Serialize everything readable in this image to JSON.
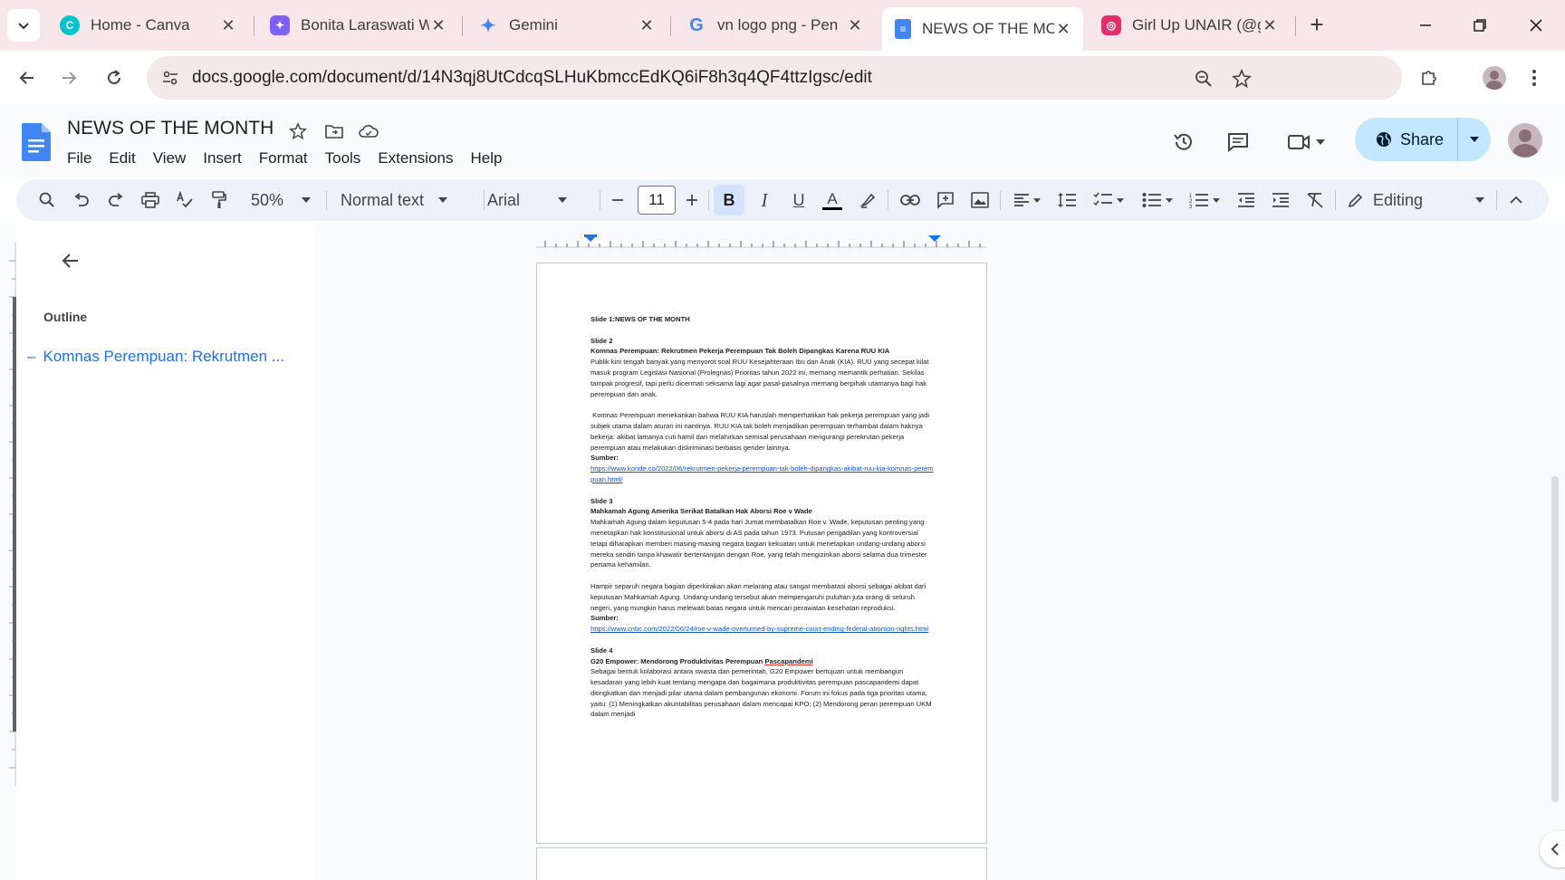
{
  "browser": {
    "tabs": [
      {
        "title": "Home - Canva",
        "favicon": "canva-icon",
        "color": "#00c4cc",
        "active": false
      },
      {
        "title": "Bonita Laraswati W",
        "favicon": "ai-chat-icon",
        "color": "#7b61ff",
        "active": false
      },
      {
        "title": "Gemini",
        "favicon": "gemini-sparkle-icon",
        "color": "#4285f4",
        "active": false
      },
      {
        "title": "vn logo png - Pen",
        "favicon": "google-g-icon",
        "color": "#4285f4",
        "active": false
      },
      {
        "title": "NEWS OF THE MO",
        "favicon": "docs-icon",
        "color": "#4285f4",
        "active": true
      },
      {
        "title": "Girl Up UNAIR (@g",
        "favicon": "instagram-icon",
        "color": "#e1306c",
        "active": false
      }
    ],
    "new_tab_label": "+",
    "url": "docs.google.com/document/d/14N3qj8UtCdcqSLHuKbmccEdKQ6iF8h3q4QF4ttzIgsc/edit"
  },
  "docs": {
    "title": "NEWS OF THE MONTH",
    "menu": [
      "File",
      "Edit",
      "View",
      "Insert",
      "Format",
      "Tools",
      "Extensions",
      "Help"
    ],
    "share_label": "Share",
    "accent": "#c2e7ff"
  },
  "toolbar": {
    "zoom": "50%",
    "style": "Normal text",
    "font": "Arial",
    "font_size": "11",
    "mode": "Editing"
  },
  "outline": {
    "label": "Outline",
    "items": [
      "Komnas Perempuan: Rekrutmen ..."
    ]
  },
  "page": {
    "slide1": "Slide 1:NEWS OF THE MONTH",
    "slide2_label": "Slide 2",
    "slide2_heading": "Komnas Perempuan: Rekrutmen Pekerja Perempuan Tak Boleh Dipangkas Karena RUU KIA",
    "slide2_p1": "Publik kini tengah banyak yang menyorot soal RUU Kesejahteraan Ibu dan Anak (KIA). RUU yang secepat kilat masuk program Legislasi Nasional (Prolegnas) Prioritas tahun 2022 ini, memang memantik perhatian. Sekilas tampak progresif, tapi perlu dicermati seksama lagi agar pasal-pasalnya memang berpihak utamanya bagi hak perempuan dan anak.",
    "slide2_p2": " Komnas Perempuan menekankan bahwa RUU KIA haruslah memperhatikan hak pekerja perempuan yang jadi subjek utama dalam aturan ini nantinya. RUU KIA tak boleh menjadikan perempuan terhambat dalam haknya bekerja: akibat lamanya cuti hamil dan melahirkan semisal perusahaan mengurangi perekrutan pekerja perempuan atau melakukan diskriminasi berbasis gender lainnya.",
    "slide2_source_label": "Sumber:",
    "slide2_source": "https://www.konde.co/2022/06/rekrutmen-pekerja-perempuan-tak-boleh-dipangkas-akibat-ruu-kia-komnas-perempuan.html/",
    "slide3_label": "Slide 3",
    "slide3_heading": "Mahkamah Agung Amerika Serikat Batalkan Hak Aborsi Roe v Wade",
    "slide3_p1": "Mahkamah Agung dalam keputusan 5-4 pada hari Jumat membatalkan Roe v. Wade, keputusan penting yang menetapkan hak konstitusional untuk aborsi di AS pada tahun 1973. Putusan pengadilan yang kontroversial tetapi diharapkan memberi masing-masing negara bagian kekuatan untuk menetapkan undang-undang aborsi mereka sendiri tanpa khawatir bertentangan dengan Roe, yang telah mengizinkan aborsi selama dua trimester pertama kehamilan.",
    "slide3_p2": "Hampir separuh negara bagian diperkirakan akan melarang atau sangat membatasi aborsi sebagai akibat dari keputusan Mahkamah Agung. Undang-undang tersebut akan mempengaruhi puluhan juta orang di seluruh negeri, yang mungkin harus melewati batas negara untuk mencari perawatan kesehatan reproduksi.",
    "slide3_source_label": "Sumber:",
    "slide3_source": "https://www.cnbc.com/2022/06/24/roe-v-wade-overturned-by-supreme-court-ending-federal-abortion-rights.html",
    "slide4_label": "Slide 4",
    "slide4_heading_a": "G20 Empower: Mendorong Produktivitas Perempuan ",
    "slide4_heading_b": "Pascapandemi",
    "slide4_p1": "Sebagai bentuk kolaborasi antara swasta dan pemerintah, G20 Empower bertujuan untuk membangun kesadaran yang lebih kuat tentang mengapa dan bagaimana produktivitas perempuan pascapandemi dapat ditingkatkan dan menjadi pilar utama dalam pembangunan ekonomi. Forum ini fokus pada tiga prioritas utama, yaitu: (1) Meningkatkan akuntabilitas perusahaan dalam mencapai KPO; (2) Mendorong peran perempuan UKM dalam menjadi"
  }
}
